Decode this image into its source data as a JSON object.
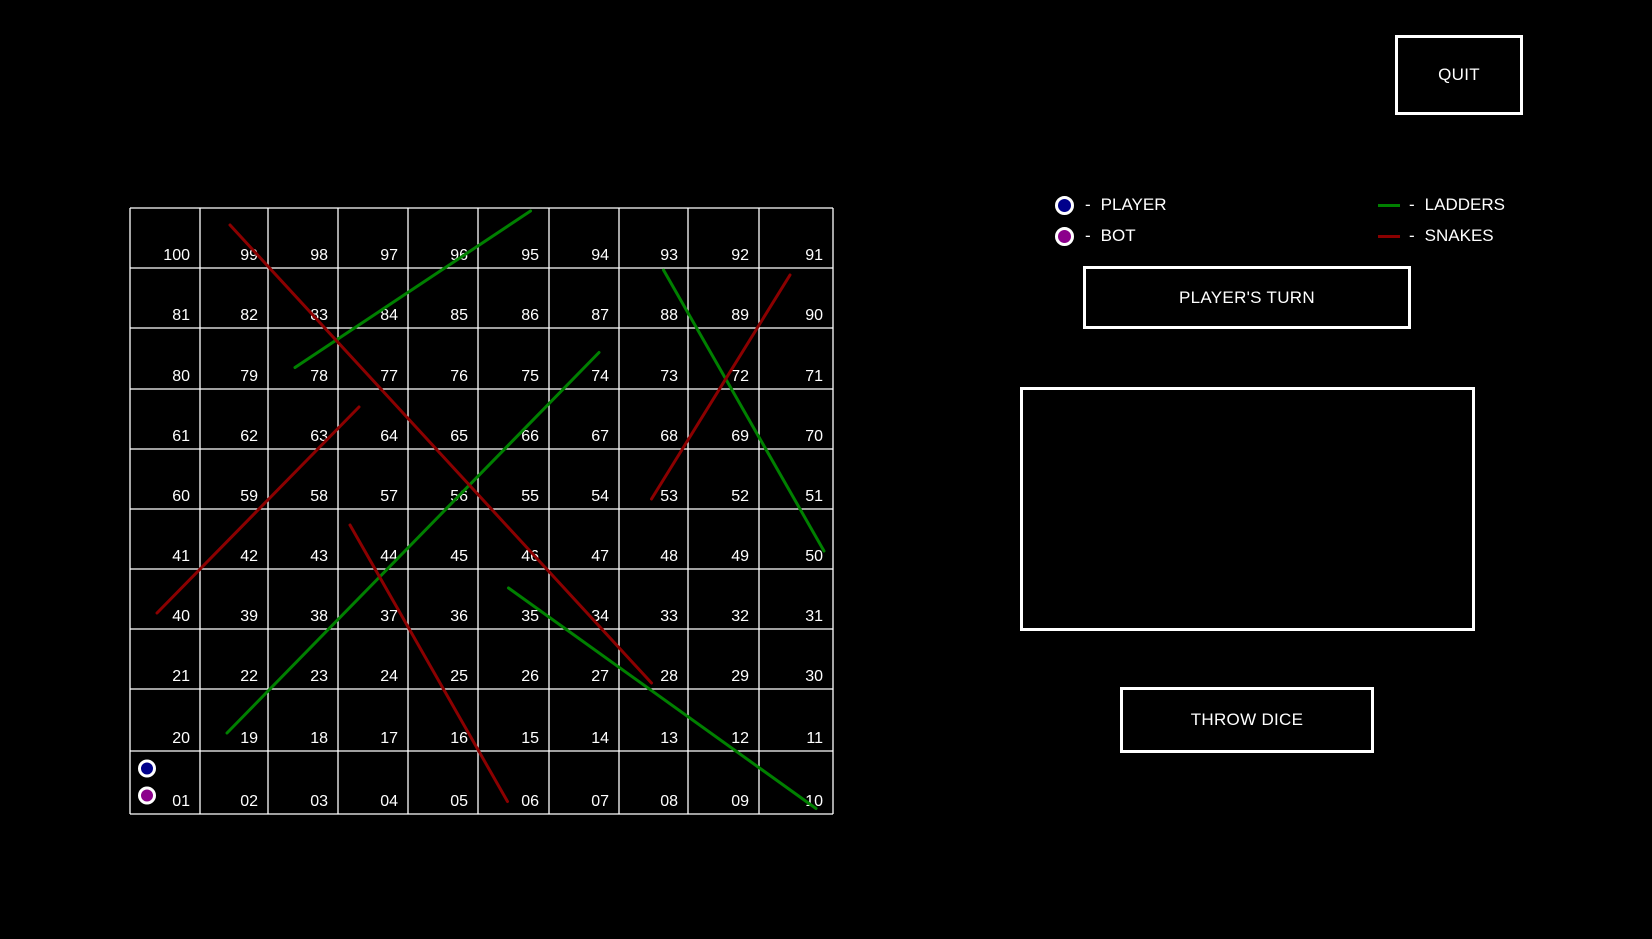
{
  "quit_label": "QUIT",
  "turn_label": "PLAYER'S TURN",
  "message_text": "",
  "throw_dice_label": "THROW DICE",
  "legend": {
    "player": {
      "dash": "-",
      "label": "PLAYER",
      "color": "#00008b"
    },
    "bot": {
      "dash": "-",
      "label": "BOT",
      "color": "#8b008b"
    },
    "ladders": {
      "dash": "-",
      "label": "LADDERS",
      "color": "#008000"
    },
    "snakes": {
      "dash": "-",
      "label": "SNAKES",
      "color": "#8b0000"
    }
  },
  "board": {
    "rows": [
      [
        "100",
        "99",
        "98",
        "97",
        "96",
        "95",
        "94",
        "93",
        "92",
        "91"
      ],
      [
        "81",
        "82",
        "83",
        "84",
        "85",
        "86",
        "87",
        "88",
        "89",
        "90"
      ],
      [
        "80",
        "79",
        "78",
        "77",
        "76",
        "75",
        "74",
        "73",
        "72",
        "71"
      ],
      [
        "61",
        "62",
        "63",
        "64",
        "65",
        "66",
        "67",
        "68",
        "69",
        "70"
      ],
      [
        "60",
        "59",
        "58",
        "57",
        "56",
        "55",
        "54",
        "53",
        "52",
        "51"
      ],
      [
        "41",
        "42",
        "43",
        "44",
        "45",
        "46",
        "47",
        "48",
        "49",
        "50"
      ],
      [
        "40",
        "39",
        "38",
        "37",
        "36",
        "35",
        "34",
        "33",
        "32",
        "31"
      ],
      [
        "21",
        "22",
        "23",
        "24",
        "25",
        "26",
        "27",
        "28",
        "29",
        "30"
      ],
      [
        "20",
        "19",
        "18",
        "17",
        "16",
        "15",
        "14",
        "13",
        "12",
        "11"
      ],
      [
        "01",
        "02",
        "03",
        "04",
        "05",
        "06",
        "07",
        "08",
        "09",
        "10"
      ]
    ],
    "ladders": [
      {
        "from": 19,
        "to": 74
      },
      {
        "from": 78,
        "to": 95
      },
      {
        "from": 35,
        "to": 10
      },
      {
        "from": 88,
        "to": 50
      }
    ],
    "snakes": [
      {
        "from": 99,
        "to": 28
      },
      {
        "from": 90,
        "to": 53
      },
      {
        "from": 64,
        "to": 40
      },
      {
        "from": 44,
        "to": 6
      }
    ],
    "player_position": 1,
    "bot_position": 1
  }
}
